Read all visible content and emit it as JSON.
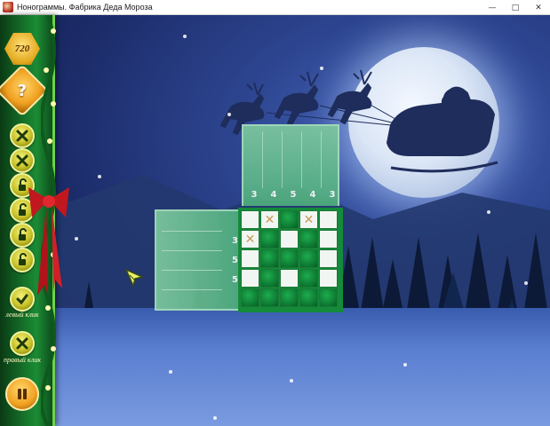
{
  "window": {
    "title": "Нонограммы. Фабрика Деда Мороза",
    "minimize": "—",
    "maximize": "□",
    "close": "✕"
  },
  "sidebar": {
    "score": "720",
    "hint_label": "?",
    "buttons": [
      {
        "icon": "cross-icon"
      },
      {
        "icon": "cross-icon"
      },
      {
        "icon": "unlocked-padlock-icon"
      },
      {
        "icon": "unlocked-padlock-icon"
      },
      {
        "icon": "unlocked-padlock-icon"
      },
      {
        "icon": "unlocked-padlock-icon"
      }
    ],
    "left_click_label": "левый клик",
    "right_click_label": "правый клик",
    "left_click_icon": "checkmark-icon",
    "right_click_icon": "cross-icon",
    "pause_icon": "pause-icon"
  },
  "puzzle": {
    "column_clues": [
      "3",
      "4",
      "5",
      "4",
      "3"
    ],
    "row_clues": [
      "",
      "3",
      "5",
      "5",
      ""
    ],
    "grid": [
      [
        "empty",
        "crossed",
        "filled",
        "crossed",
        "empty"
      ],
      [
        "crossed",
        "filled",
        "empty",
        "filled",
        "empty"
      ],
      [
        "empty",
        "filled",
        "filled",
        "filled",
        "empty"
      ],
      [
        "empty",
        "filled",
        "empty",
        "filled",
        "empty"
      ],
      [
        "filled",
        "filled",
        "filled",
        "filled",
        "filled"
      ]
    ]
  },
  "colors": {
    "sidebar_green": "#15712a",
    "filled_cell": "#0d7a33",
    "empty_cell": "#f2f6f2",
    "cross_mark": "#c89a5a",
    "gold": "#f0a020",
    "sky": "#1c2c6a"
  }
}
